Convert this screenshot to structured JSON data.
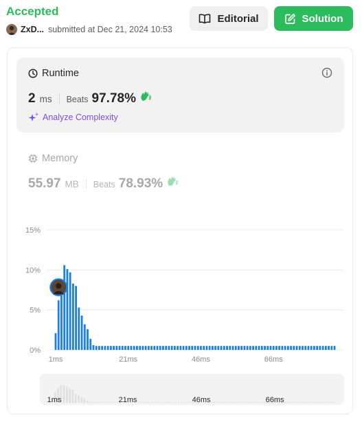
{
  "submission": {
    "status": "Accepted",
    "author": "ZxD...",
    "submitted_text": "submitted at Dec 21, 2024 10:53"
  },
  "buttons": {
    "editorial": "Editorial",
    "solution": "Solution"
  },
  "runtime": {
    "title": "Runtime",
    "value": "2",
    "unit": "ms",
    "beats_label": "Beats",
    "beats_value": "97.78%",
    "analyze_label": "Analyze Complexity"
  },
  "memory": {
    "title": "Memory",
    "value": "55.97",
    "unit": "MB",
    "beats_label": "Beats",
    "beats_value": "78.93%"
  },
  "colors": {
    "accepted": "#2cbb5d",
    "bar": "#1a7fe8",
    "navigator_bar": "#e0e0e0",
    "analyze": "#7b4ee3"
  },
  "chart_data": {
    "type": "bar",
    "ylim": [
      0,
      15
    ],
    "y_ticks": [
      "0%",
      "5%",
      "10%",
      "15%"
    ],
    "x_tick_labels": [
      "1ms",
      "21ms",
      "46ms",
      "66ms"
    ],
    "x_tick_indices": [
      0,
      25,
      50,
      75
    ],
    "values": [
      2.1,
      6.2,
      8.8,
      10.6,
      10.1,
      9.7,
      8.3,
      8.0,
      5.3,
      4.3,
      3.2,
      2.6,
      1.4,
      0.6,
      0.5,
      0.5,
      0.5,
      0.5,
      0.5,
      0.5,
      0.5,
      0.5,
      0.5,
      0.5,
      0.5,
      0.5,
      0.5,
      0.5,
      0.5,
      0.5,
      0.5,
      0.5,
      0.5,
      0.5,
      0.5,
      0.5,
      0.5,
      0.5,
      0.5,
      0.5,
      0.5,
      0.5,
      0.5,
      0.5,
      0.5,
      0.5,
      0.5,
      0.5,
      0.5,
      0.5,
      0.5,
      0.5,
      0.5,
      0.5,
      0.5,
      0.5,
      0.5,
      0.5,
      0.5,
      0.5,
      0.5,
      0.5,
      0.5,
      0.5,
      0.5,
      0.5,
      0.5,
      0.5,
      0.5,
      0.5,
      0.5,
      0.5,
      0.5,
      0.5,
      0.5,
      0.5,
      0.5,
      0.5,
      0.5,
      0.5,
      0.5,
      0.5,
      0.5,
      0.5,
      0.5,
      0.5,
      0.5,
      0.5,
      0.5,
      0.5,
      0.5,
      0.5,
      0.5,
      0.5,
      0.5,
      0.5,
      0.5
    ],
    "marker_index": 1,
    "grid": true,
    "legend": "none"
  }
}
